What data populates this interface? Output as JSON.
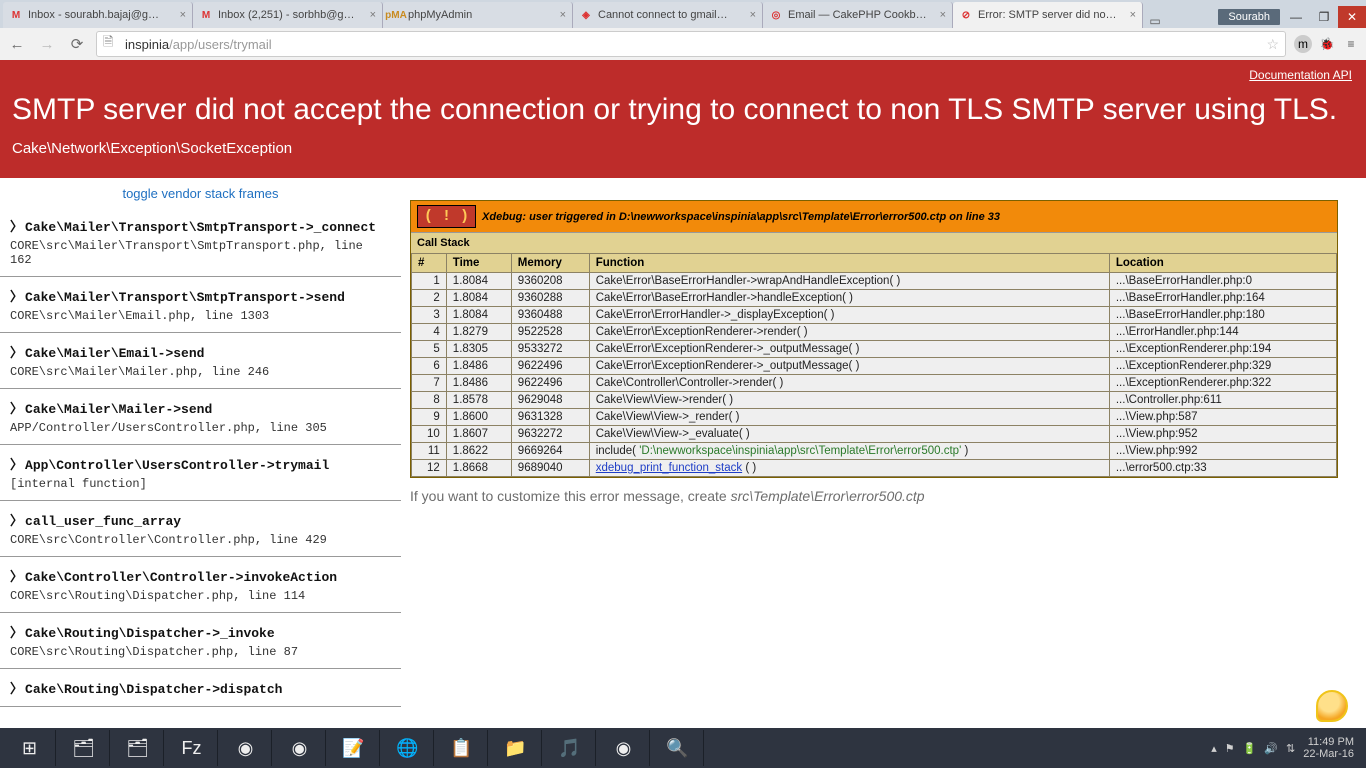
{
  "window": {
    "user_button": "Sourabh",
    "tabs": [
      {
        "icon": "M",
        "iconColor": "#d33",
        "title": "Inbox - sourabh.bajaj@g…"
      },
      {
        "icon": "M",
        "iconColor": "#d33",
        "title": "Inbox (2,251) - sorbhb@g…"
      },
      {
        "icon": "pMA",
        "iconColor": "#c98b20",
        "title": "phpMyAdmin"
      },
      {
        "icon": "◈",
        "iconColor": "#d33",
        "title": "Cannot connect to gmail…"
      },
      {
        "icon": "◎",
        "iconColor": "#d33",
        "title": "Email — CakePHP Cookb…"
      },
      {
        "icon": "⊘",
        "iconColor": "#d33",
        "title": "Error: SMTP server did no…",
        "active": true
      }
    ],
    "url_host": "inspinia",
    "url_path": "/app/users/trymail"
  },
  "header": {
    "doc_link": "Documentation API",
    "title": "SMTP server did not accept the connection or trying to connect to non TLS SMTP server using TLS.",
    "exception_class": "Cake\\Network\\Exception\\SocketException"
  },
  "left": {
    "toggle": "toggle vendor stack frames",
    "frames": [
      {
        "fn": "Cake\\Mailer\\Transport\\SmtpTransport->_connect",
        "path": "CORE\\src\\Mailer\\Transport\\SmtpTransport.php, line 162"
      },
      {
        "fn": "Cake\\Mailer\\Transport\\SmtpTransport->send",
        "path": "CORE\\src\\Mailer\\Email.php, line 1303"
      },
      {
        "fn": "Cake\\Mailer\\Email->send",
        "path": "CORE\\src\\Mailer\\Mailer.php, line 246"
      },
      {
        "fn": "Cake\\Mailer\\Mailer->send",
        "path": "APP/Controller/UsersController.php, line 305"
      },
      {
        "fn": "App\\Controller\\UsersController->trymail",
        "path": "[internal function]"
      },
      {
        "fn": "call_user_func_array",
        "path": "CORE\\src\\Controller\\Controller.php, line 429"
      },
      {
        "fn": "Cake\\Controller\\Controller->invokeAction",
        "path": "CORE\\src\\Routing\\Dispatcher.php, line 114"
      },
      {
        "fn": "Cake\\Routing\\Dispatcher->_invoke",
        "path": "CORE\\src\\Routing\\Dispatcher.php, line 87"
      },
      {
        "fn": "Cake\\Routing\\Dispatcher->dispatch",
        "path": ""
      }
    ]
  },
  "xdebug": {
    "badge": "( ! )",
    "msg_pre": "Xdebug: user triggered in D:\\newworkspace\\inspinia\\app\\src\\Template\\Error\\error500.ctp on line ",
    "msg_line": "33",
    "callstack_title": "Call Stack",
    "headers": {
      "n": "#",
      "time": "Time",
      "mem": "Memory",
      "fn": "Function",
      "loc": "Location"
    },
    "rows": [
      {
        "n": 1,
        "t": "1.8084",
        "m": "9360208",
        "fn": "Cake\\Error\\BaseErrorHandler->wrapAndHandleException( )",
        "loc": "...\\BaseErrorHandler.php:0"
      },
      {
        "n": 2,
        "t": "1.8084",
        "m": "9360288",
        "fn": "Cake\\Error\\BaseErrorHandler->handleException( )",
        "loc": "...\\BaseErrorHandler.php:164"
      },
      {
        "n": 3,
        "t": "1.8084",
        "m": "9360488",
        "fn": "Cake\\Error\\ErrorHandler->_displayException( )",
        "loc": "...\\BaseErrorHandler.php:180"
      },
      {
        "n": 4,
        "t": "1.8279",
        "m": "9522528",
        "fn": "Cake\\Error\\ExceptionRenderer->render( )",
        "loc": "...\\ErrorHandler.php:144"
      },
      {
        "n": 5,
        "t": "1.8305",
        "m": "9533272",
        "fn": "Cake\\Error\\ExceptionRenderer->_outputMessage( )",
        "loc": "...\\ExceptionRenderer.php:194"
      },
      {
        "n": 6,
        "t": "1.8486",
        "m": "9622496",
        "fn": "Cake\\Error\\ExceptionRenderer->_outputMessage( )",
        "loc": "...\\ExceptionRenderer.php:329"
      },
      {
        "n": 7,
        "t": "1.8486",
        "m": "9622496",
        "fn": "Cake\\Controller\\Controller->render( )",
        "loc": "...\\ExceptionRenderer.php:322"
      },
      {
        "n": 8,
        "t": "1.8578",
        "m": "9629048",
        "fn": "Cake\\View\\View->render( )",
        "loc": "...\\Controller.php:611"
      },
      {
        "n": 9,
        "t": "1.8600",
        "m": "9631328",
        "fn": "Cake\\View\\View->_render( )",
        "loc": "...\\View.php:587"
      },
      {
        "n": 10,
        "t": "1.8607",
        "m": "9632272",
        "fn": "Cake\\View\\View->_evaluate( )",
        "loc": "...\\View.php:952"
      },
      {
        "n": 11,
        "t": "1.8622",
        "m": "9669264",
        "fn": "include( ",
        "arg": "'D:\\newworkspace\\inspinia\\app\\src\\Template\\Error\\error500.ctp'",
        "fn2": " )",
        "loc": "...\\View.php:992"
      },
      {
        "n": 12,
        "t": "1.8668",
        "m": "9689040",
        "link": "xdebug_print_function_stack",
        "fn2": " ( )",
        "loc": "...\\error500.ctp:33"
      }
    ]
  },
  "customize": {
    "pre": "If you want to customize this error message, create ",
    "path": "src\\Template\\Error\\error500.ctp"
  },
  "taskbar": {
    "icons": [
      "⊞",
      "🗂",
      "🗂",
      "Fz",
      "◉",
      "◉",
      "📝",
      "🌐",
      "📋",
      "📁",
      "🎵",
      "◉",
      "🔍"
    ],
    "time": "11:49 PM",
    "date": "22-Mar-16"
  }
}
